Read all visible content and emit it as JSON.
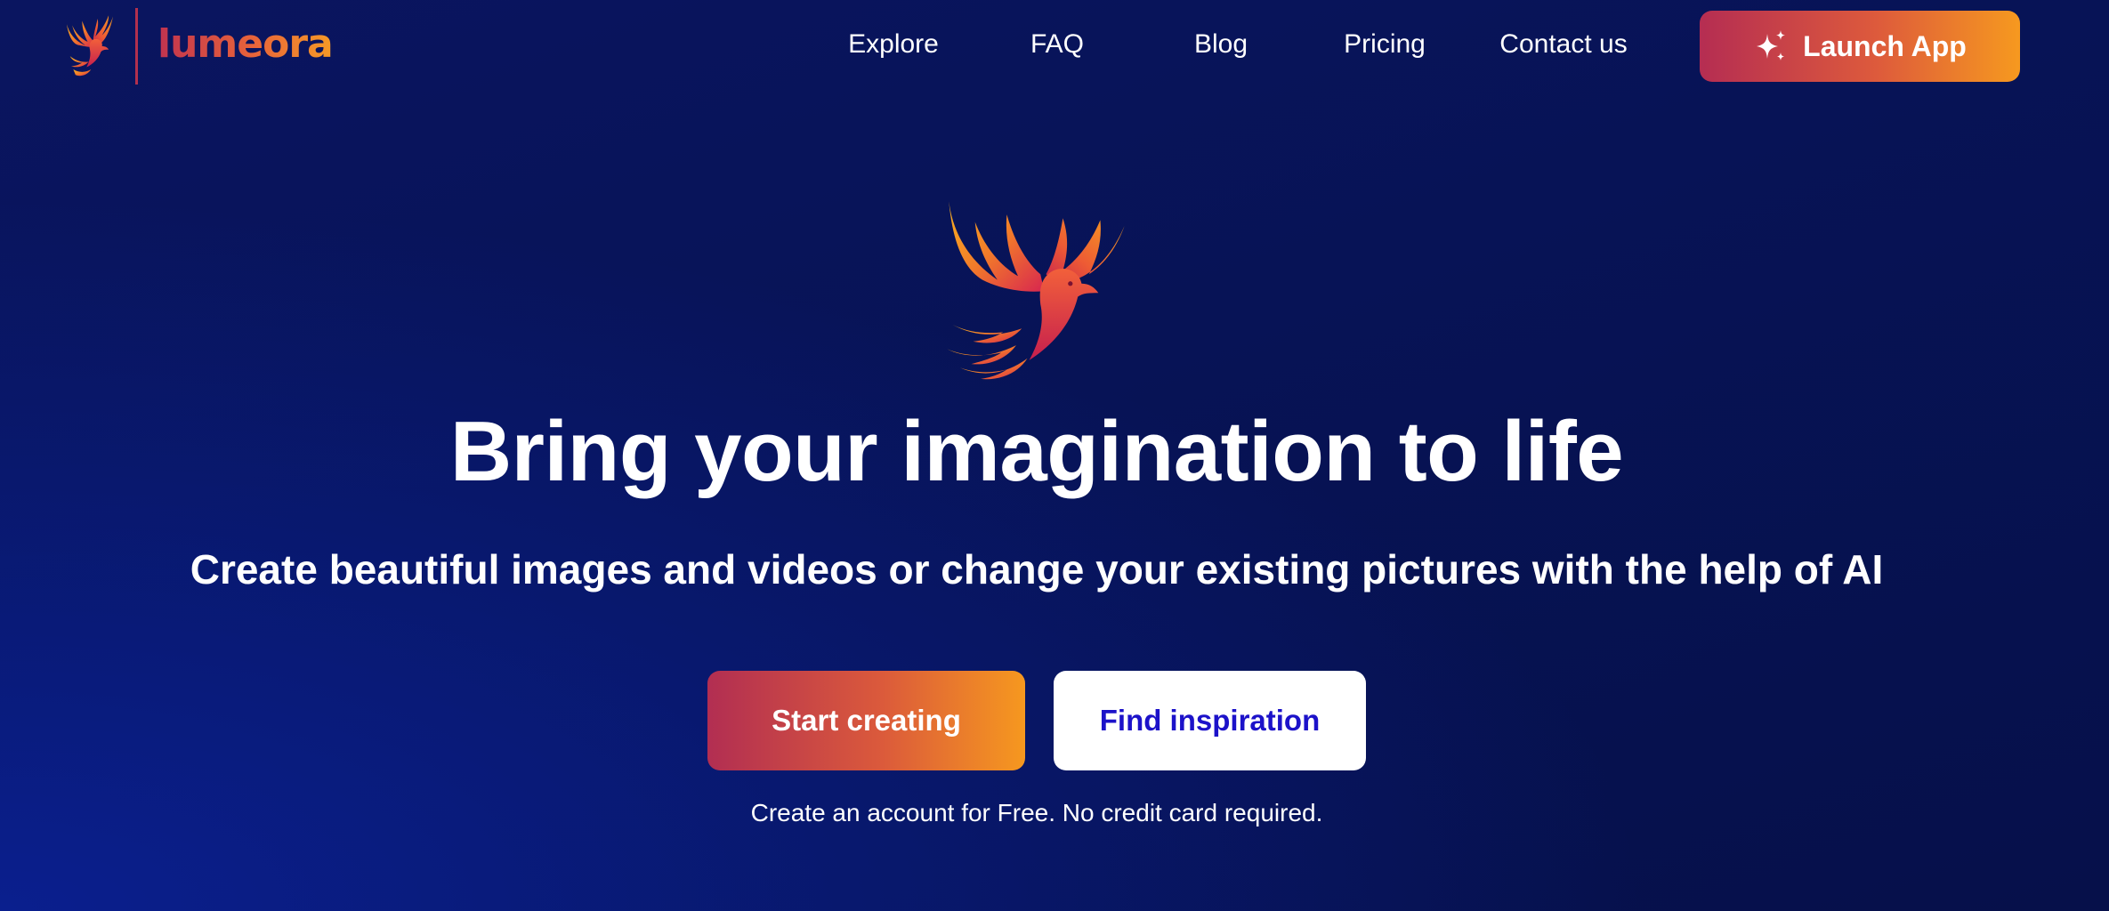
{
  "header": {
    "brand_name": "lumeora",
    "nav": [
      {
        "label": "Explore"
      },
      {
        "label": "FAQ"
      },
      {
        "label": "Blog"
      },
      {
        "label": "Pricing"
      },
      {
        "label": "Contact us"
      }
    ],
    "launch_button": {
      "label": "Launch App",
      "icon": "sparkles-icon"
    }
  },
  "hero": {
    "logo_icon": "phoenix-icon",
    "title": "Bring your imagination to life",
    "subtitle": "Create beautiful images and videos or change your existing pictures with the help of AI",
    "primary_cta": "Start creating",
    "secondary_cta": "Find inspiration",
    "note": "Create an account for Free. No credit card required."
  },
  "colors": {
    "background": "#071356",
    "accent_start": "#b52d52",
    "accent_end": "#f6991f",
    "secondary_text": "#1c12c9",
    "text": "#ffffff"
  }
}
